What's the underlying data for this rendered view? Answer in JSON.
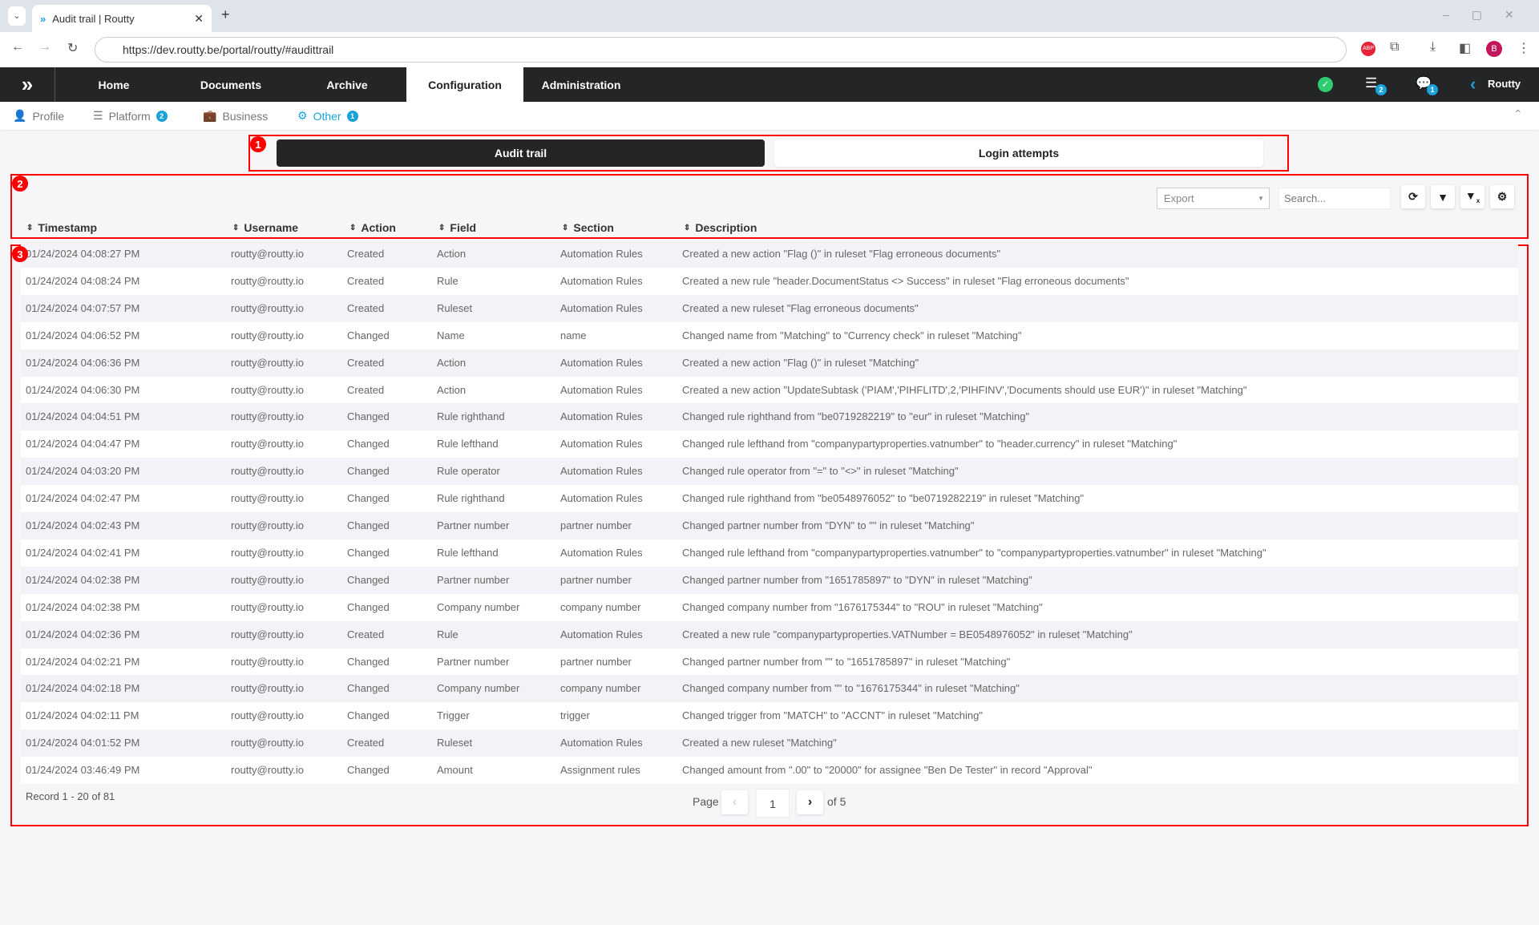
{
  "browser": {
    "tab_title": "Audit trail | Routty",
    "url": "https://dev.routty.be/portal/routty/#audittrail",
    "profile_initial": "B",
    "ext_label": "ABP"
  },
  "nav": {
    "items": [
      "Home",
      "Documents",
      "Archive",
      "Configuration",
      "Administration"
    ],
    "active": "Configuration",
    "list_badge": "2",
    "chat_badge": "1",
    "user": "Routty"
  },
  "subnav": {
    "items": [
      {
        "label": "Profile",
        "icon": "user-icon"
      },
      {
        "label": "Platform",
        "icon": "database-icon",
        "badge": "2"
      },
      {
        "label": "Business",
        "icon": "briefcase-icon"
      },
      {
        "label": "Other",
        "icon": "gear-icon",
        "badge": "1"
      }
    ],
    "active": "Other"
  },
  "markers": [
    "1",
    "2",
    "3"
  ],
  "segments": {
    "audit": "Audit trail",
    "login": "Login attempts"
  },
  "toolbar": {
    "export": "Export",
    "search_placeholder": "Search..."
  },
  "table": {
    "columns": [
      "Timestamp",
      "Username",
      "Action",
      "Field",
      "Section",
      "Description"
    ],
    "rows": [
      [
        "01/24/2024 04:08:27 PM",
        "routty@routty.io",
        "Created",
        "Action",
        "Automation Rules",
        "Created a new action \"Flag ()\" in ruleset \"Flag erroneous documents\""
      ],
      [
        "01/24/2024 04:08:24 PM",
        "routty@routty.io",
        "Created",
        "Rule",
        "Automation Rules",
        "Created a new rule \"header.DocumentStatus <> Success\" in ruleset \"Flag erroneous documents\""
      ],
      [
        "01/24/2024 04:07:57 PM",
        "routty@routty.io",
        "Created",
        "Ruleset",
        "Automation Rules",
        "Created a new ruleset \"Flag erroneous documents\""
      ],
      [
        "01/24/2024 04:06:52 PM",
        "routty@routty.io",
        "Changed",
        "Name",
        "name",
        "Changed name from \"Matching\" to \"Currency check\" in ruleset \"Matching\""
      ],
      [
        "01/24/2024 04:06:36 PM",
        "routty@routty.io",
        "Created",
        "Action",
        "Automation Rules",
        "Created a new action \"Flag ()\" in ruleset \"Matching\""
      ],
      [
        "01/24/2024 04:06:30 PM",
        "routty@routty.io",
        "Created",
        "Action",
        "Automation Rules",
        "Created a new action \"UpdateSubtask ('PIAM','PIHFLITD',2,'PIHFINV','Documents should use EUR')\" in ruleset \"Matching\""
      ],
      [
        "01/24/2024 04:04:51 PM",
        "routty@routty.io",
        "Changed",
        "Rule righthand",
        "Automation Rules",
        "Changed rule righthand from \"be0719282219\" to \"eur\" in ruleset \"Matching\""
      ],
      [
        "01/24/2024 04:04:47 PM",
        "routty@routty.io",
        "Changed",
        "Rule lefthand",
        "Automation Rules",
        "Changed rule lefthand from \"companypartyproperties.vatnumber\" to \"header.currency\" in ruleset \"Matching\""
      ],
      [
        "01/24/2024 04:03:20 PM",
        "routty@routty.io",
        "Changed",
        "Rule operator",
        "Automation Rules",
        "Changed rule operator from \"=\" to \"<>\" in ruleset \"Matching\""
      ],
      [
        "01/24/2024 04:02:47 PM",
        "routty@routty.io",
        "Changed",
        "Rule righthand",
        "Automation Rules",
        "Changed rule righthand from \"be0548976052\" to \"be0719282219\" in ruleset \"Matching\""
      ],
      [
        "01/24/2024 04:02:43 PM",
        "routty@routty.io",
        "Changed",
        "Partner number",
        "partner number",
        "Changed partner number from \"DYN\" to \"\" in ruleset \"Matching\""
      ],
      [
        "01/24/2024 04:02:41 PM",
        "routty@routty.io",
        "Changed",
        "Rule lefthand",
        "Automation Rules",
        "Changed rule lefthand from \"companypartyproperties.vatnumber\" to \"companypartyproperties.vatnumber\" in ruleset \"Matching\""
      ],
      [
        "01/24/2024 04:02:38 PM",
        "routty@routty.io",
        "Changed",
        "Partner number",
        "partner number",
        "Changed partner number from \"1651785897\" to \"DYN\" in ruleset \"Matching\""
      ],
      [
        "01/24/2024 04:02:38 PM",
        "routty@routty.io",
        "Changed",
        "Company number",
        "company number",
        "Changed company number from \"1676175344\" to \"ROU\" in ruleset \"Matching\""
      ],
      [
        "01/24/2024 04:02:36 PM",
        "routty@routty.io",
        "Created",
        "Rule",
        "Automation Rules",
        "Created a new rule \"companypartyproperties.VATNumber = BE0548976052\" in ruleset \"Matching\""
      ],
      [
        "01/24/2024 04:02:21 PM",
        "routty@routty.io",
        "Changed",
        "Partner number",
        "partner number",
        "Changed partner number from \"\" to \"1651785897\" in ruleset \"Matching\""
      ],
      [
        "01/24/2024 04:02:18 PM",
        "routty@routty.io",
        "Changed",
        "Company number",
        "company number",
        "Changed company number from \"\" to \"1676175344\" in ruleset \"Matching\""
      ],
      [
        "01/24/2024 04:02:11 PM",
        "routty@routty.io",
        "Changed",
        "Trigger",
        "trigger",
        "Changed trigger from \"MATCH\" to \"ACCNT\" in ruleset \"Matching\""
      ],
      [
        "01/24/2024 04:01:52 PM",
        "routty@routty.io",
        "Created",
        "Ruleset",
        "Automation Rules",
        "Created a new ruleset \"Matching\""
      ],
      [
        "01/24/2024 03:46:49 PM",
        "routty@routty.io",
        "Changed",
        "Amount",
        "Assignment rules",
        "Changed amount from \".00\" to \"20000\" for assignee \"Ben De Tester\" in record \"Approval\""
      ]
    ]
  },
  "footer": {
    "records": "Record 1 - 20 of 81",
    "page_label": "Page",
    "page": "1",
    "of": "of 5"
  },
  "colors": {
    "accent": "#1aa3d9",
    "nav_bg": "#232526",
    "annotation": "#ff0000"
  }
}
